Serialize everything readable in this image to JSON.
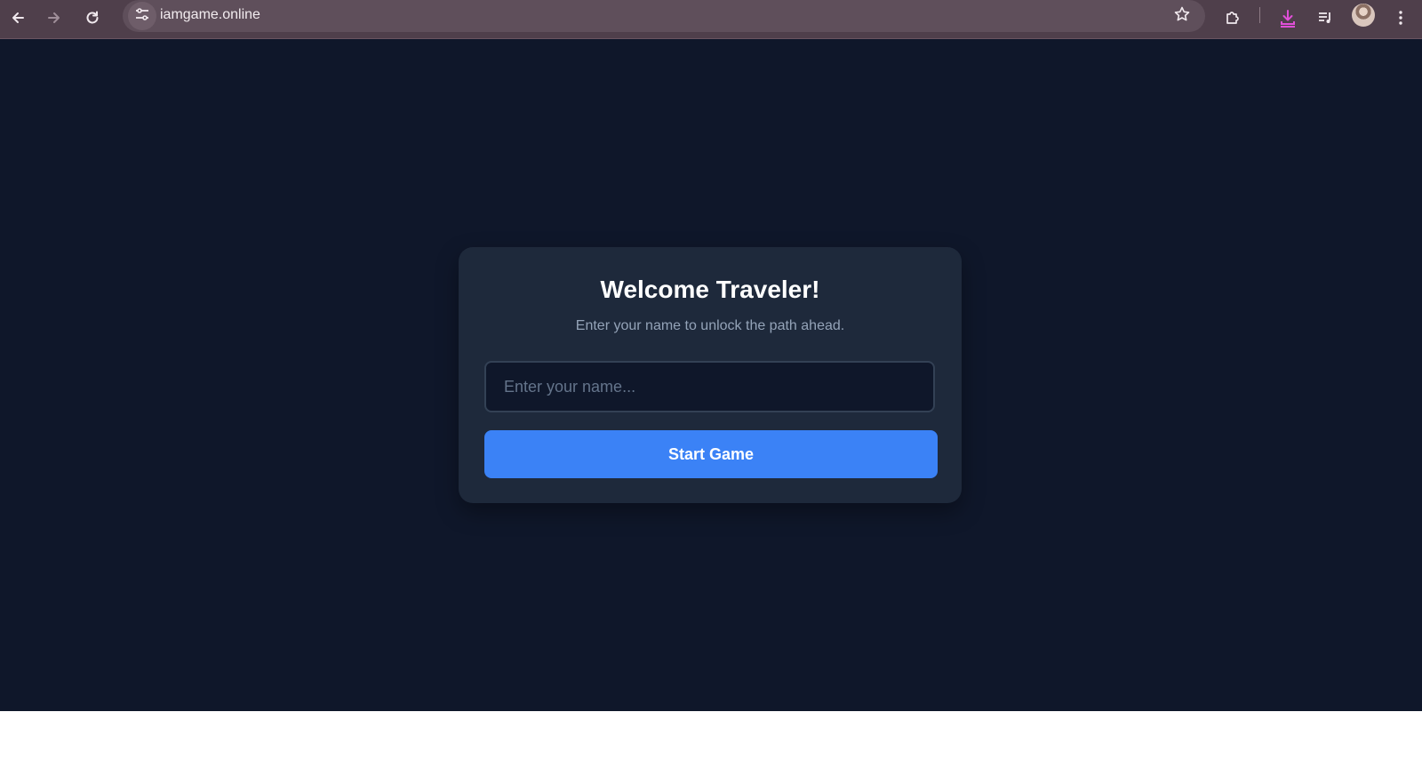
{
  "browser": {
    "url": "iamgame.online",
    "icons": {
      "back": "arrow-left-icon",
      "forward": "arrow-right-icon",
      "reload": "reload-icon",
      "site_info": "tune-icon",
      "bookmark": "star-icon",
      "extensions": "puzzle-icon",
      "downloads": "download-icon",
      "media": "playlist-icon",
      "profile": "avatar",
      "menu": "kebab-menu-icon"
    },
    "colors": {
      "frame": "#4f3f4b",
      "omnibox": "#5f4f5b",
      "download_accent": "#e04fd8"
    }
  },
  "page": {
    "background": "#0f172a",
    "card": {
      "title": "Welcome Traveler!",
      "subtitle": "Enter your name to unlock the path ahead.",
      "name_input": {
        "placeholder": "Enter your name...",
        "value": ""
      },
      "start_button": {
        "label": "Start Game",
        "color": "#3b82f6"
      }
    }
  }
}
